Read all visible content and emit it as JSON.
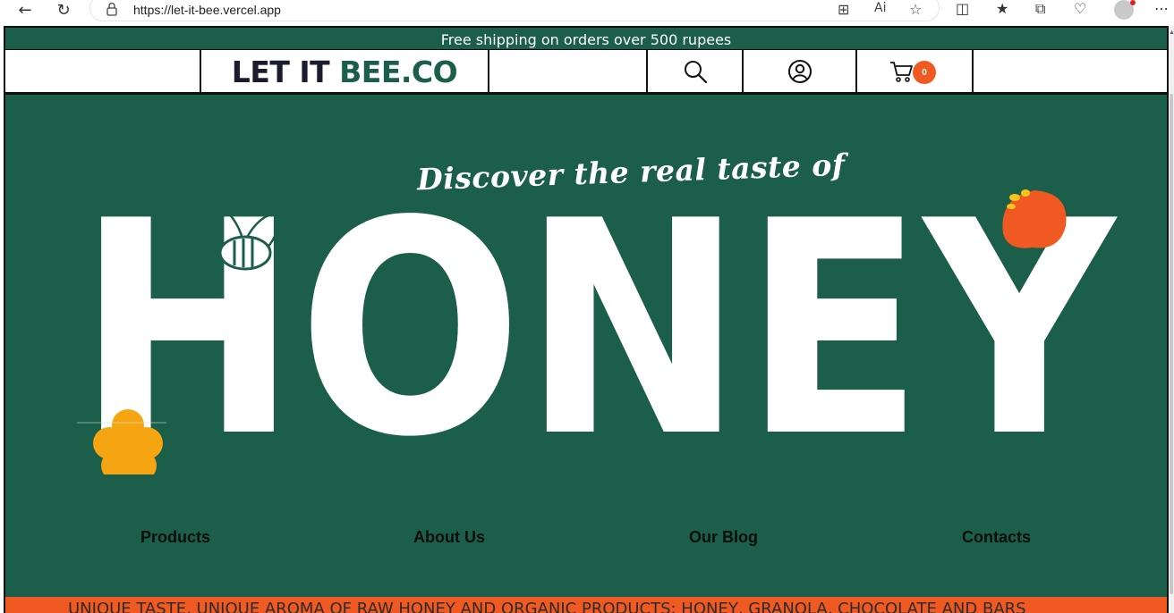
{
  "browser": {
    "url": "https://let-it-bee.vercel.app"
  },
  "announcement": "Free shipping on orders over 500 rupees",
  "header": {
    "logo_dark": "LET IT ",
    "logo_accent": "BEE.CO",
    "cart_count": "0"
  },
  "hero": {
    "tagline": "Discover the real taste of",
    "headline": "HONEY"
  },
  "nav": {
    "products": "Products",
    "about": "About Us",
    "blog": "Our Blog",
    "contacts": "Contacts"
  },
  "marquee": "UNIQUE TASTE, UNIQUE AROMA OF RAW HONEY AND ORGANIC PRODUCTS: HONEY, GRANOLA, CHOCOLATE AND BARS",
  "colors": {
    "brand_green": "#1b5e4a",
    "accent_orange": "#f05a22",
    "flower_yellow": "#f5a412",
    "text_dark": "#1c1c2e"
  }
}
